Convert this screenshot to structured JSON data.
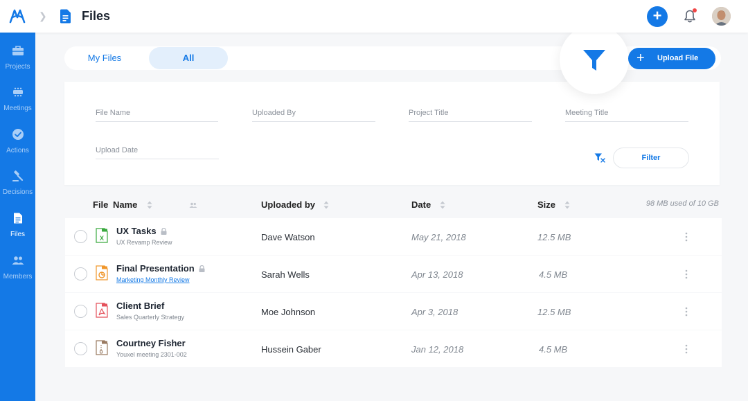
{
  "header": {
    "title": "Files"
  },
  "sidebar": {
    "items": [
      {
        "label": "Projects",
        "icon": "briefcase-icon",
        "active": false
      },
      {
        "label": "Meetings",
        "icon": "meeting-table-icon",
        "active": false
      },
      {
        "label": "Actions",
        "icon": "check-circle-icon",
        "active": false
      },
      {
        "label": "Decisions",
        "icon": "gavel-icon",
        "active": false
      },
      {
        "label": "Files",
        "icon": "file-icon",
        "active": true
      },
      {
        "label": "Members",
        "icon": "people-icon",
        "active": false
      }
    ]
  },
  "tabs": [
    {
      "label": "My Files",
      "active": false
    },
    {
      "label": "All",
      "active": true
    }
  ],
  "upload_button": {
    "label": "Upload File"
  },
  "filters": {
    "file_name": {
      "placeholder": "File Name"
    },
    "uploaded_by": {
      "placeholder": "Uploaded By"
    },
    "project_title": {
      "placeholder": "Project Title"
    },
    "meeting_title": {
      "placeholder": "Meeting Title"
    },
    "upload_date": {
      "placeholder": "Upload Date"
    },
    "apply_label": "Filter"
  },
  "table": {
    "columns": {
      "file": "File",
      "name": "Name",
      "uploaded_by": "Uploaded by",
      "date": "Date",
      "size": "Size"
    },
    "storage_text": "98 MB used of 10 GB",
    "rows": [
      {
        "name": "UX Tasks",
        "subtitle": "UX Revamp Review",
        "subtitle_link": false,
        "locked": true,
        "file_type": "xls",
        "uploaded_by": "Dave Watson",
        "date": "May 21, 2018",
        "size": "12.5 MB"
      },
      {
        "name": "Final Presentation",
        "subtitle": "Marketing Monthly Review",
        "subtitle_link": true,
        "locked": true,
        "file_type": "ppt",
        "uploaded_by": "Sarah Wells",
        "date": "Apr 13, 2018",
        "size": "4.5 MB"
      },
      {
        "name": "Client Brief",
        "subtitle": "Sales Quarterly Strategy",
        "subtitle_link": false,
        "locked": false,
        "file_type": "pdf",
        "uploaded_by": "Moe Johnson",
        "date": "Apr 3, 2018",
        "size": "12.5 MB"
      },
      {
        "name": "Courtney Fisher",
        "subtitle": "Youxel meeting 2301-002",
        "subtitle_link": false,
        "locked": false,
        "file_type": "zip",
        "uploaded_by": "Hussein Gaber",
        "date": "Jan 12, 2018",
        "size": "4.5 MB"
      }
    ]
  },
  "colors": {
    "primary": "#1479e6",
    "xls": "#3aa93f",
    "ppt": "#f0962a",
    "pdf": "#e4515b",
    "zip": "#9a7b62",
    "notification_dot": "#f04646"
  }
}
